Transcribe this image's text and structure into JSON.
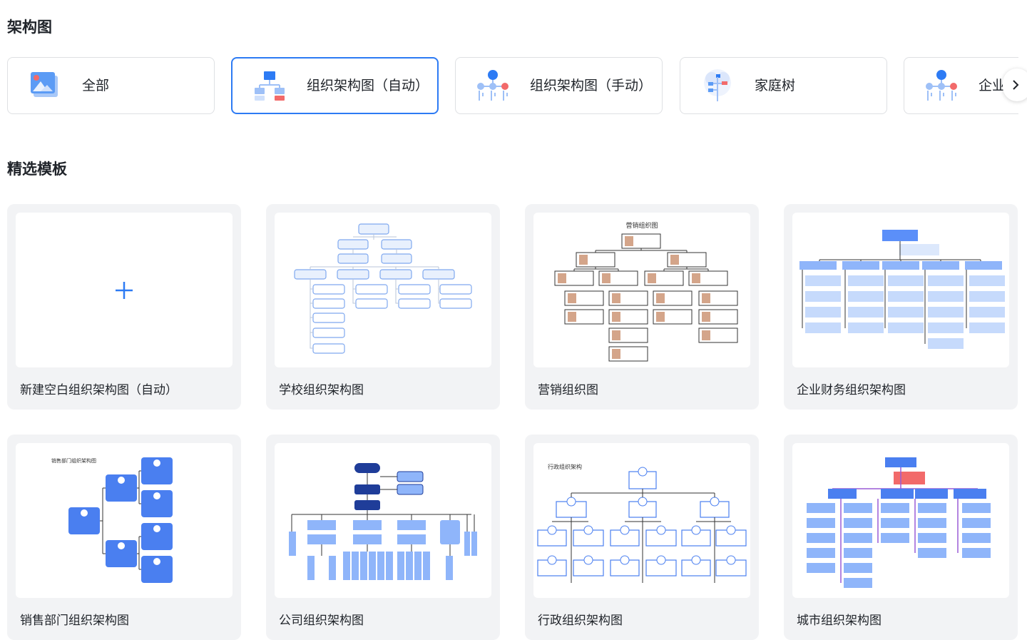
{
  "categories_title": "架构图",
  "categories": [
    {
      "label": "全部",
      "icon": "image-gallery-icon",
      "active": false
    },
    {
      "label": "组织架构图（自动）",
      "icon": "org-chart-auto-icon",
      "active": true
    },
    {
      "label": "组织架构图（手动）",
      "icon": "org-chart-manual-icon",
      "active": false
    },
    {
      "label": "家庭树",
      "icon": "family-tree-icon",
      "active": false
    },
    {
      "label": "企业",
      "icon": "enterprise-chart-icon",
      "active": false
    }
  ],
  "scroll_icon": "chevron-right-icon",
  "templates_title": "精选模板",
  "templates": [
    {
      "name": "新建空白组织架构图（自动）",
      "thumb": "blank-plus"
    },
    {
      "name": "学校组织架构图",
      "thumb": "school-org-chart"
    },
    {
      "name": "营销组织图",
      "thumb": "marketing-org-chart",
      "thumb_title": "营销组织图"
    },
    {
      "name": "企业财务组织架构图",
      "thumb": "finance-org-chart"
    },
    {
      "name": "销售部门组织架构图",
      "thumb": "sales-org-chart",
      "thumb_title": "销售部门组织架构图"
    },
    {
      "name": "公司组织架构图",
      "thumb": "company-org-chart"
    },
    {
      "name": "行政组织架构图",
      "thumb": "admin-org-chart",
      "thumb_title": "行政组织架构"
    },
    {
      "name": "城市组织架构图",
      "thumb": "city-org-chart"
    }
  ],
  "colors": {
    "accent": "#2d7bf4",
    "card_bg": "#f2f3f5",
    "node_blue": "#5b8ff9",
    "node_light": "#dce8fc",
    "node_red": "#f26a6a"
  }
}
